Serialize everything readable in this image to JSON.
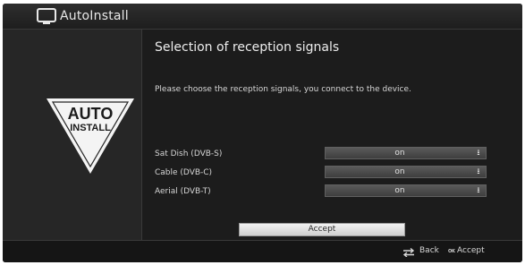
{
  "window": {
    "title": "AutoInstall"
  },
  "logo": {
    "line1": "AUTO",
    "line2": "INSTALL"
  },
  "main": {
    "heading": "Selection of reception signals",
    "description": "Please choose the reception signals, you connect to the device.",
    "rows": [
      {
        "label": "Sat Dish (DVB-S)",
        "value": "on"
      },
      {
        "label": "Cable (DVB-C)",
        "value": "on"
      },
      {
        "label": "Aerial (DVB-T)",
        "value": "on"
      }
    ],
    "accept_label": "Accept"
  },
  "footer": {
    "back_label": "Back",
    "ok_key": "OK",
    "accept_label": "Accept"
  },
  "icons": {
    "title": "tv-icon",
    "back": "swap-arrows-icon",
    "accept": "ok-key-icon",
    "select": "dropdown-arrow-icon"
  }
}
